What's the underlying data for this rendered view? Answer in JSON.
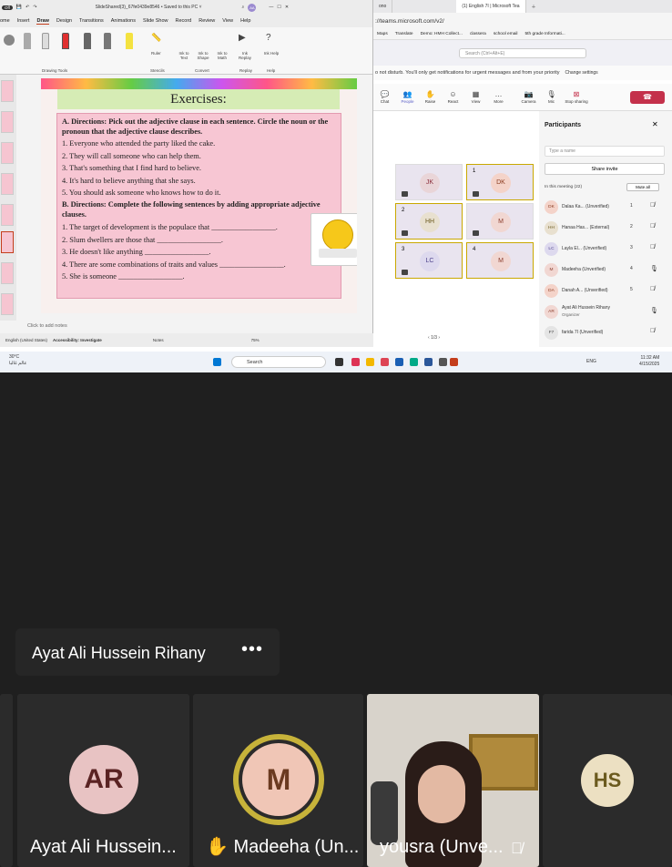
{
  "ppt": {
    "autosave": "Off",
    "filename": "SlideShared(3)_67fe0439e8546 • Saved to this PC ˅",
    "user_initials": "AA",
    "menu": [
      "ome",
      "Insert",
      "Draw",
      "Design",
      "Transitions",
      "Animations",
      "Slide Show",
      "Record",
      "Review",
      "View",
      "Help"
    ],
    "ribbon_labels": {
      "drawing_tools": "Drawing Tools",
      "stencils": "Stencils",
      "convert": "Convert",
      "replay": "Replay",
      "help": "Help",
      "ruler": "Ruler",
      "ink_to_text": "Ink to Text",
      "ink_to_shape": "Ink to Shape",
      "ink_to_math": "Ink to Math",
      "ink_replay": "Ink Replay",
      "ink_help": "Ink Help"
    },
    "notes_placeholder": "Click to add notes",
    "status": {
      "language": "English (United States)",
      "accessibility": "Accessibility: Investigate",
      "notes": "Notes",
      "zoom": "75%"
    }
  },
  "slide": {
    "title": "Exercises:",
    "section_a": "A. Directions: Pick out the adjective clause in each sentence. Circle the noun or the pronoun that the adjective clause describes.",
    "a_items": [
      "1. Everyone who attended the party liked the cake.",
      "2. They will call someone who can help them.",
      "3. That's something that I find hard to believe.",
      "4. It's hard to believe anything that she says.",
      "5. You should ask someone who knows how to do it."
    ],
    "section_b": "B. Directions: Complete the following sentences by adding appropriate adjective clauses.",
    "b_items": [
      "1.   The target of development is the populace that _________________.",
      "2.   Slum dwellers are those that _________________.",
      "3.   He doesn't like anything _________________.",
      "4.   There are some combinations of traits and values _________________.",
      "5.   She is someone _________________."
    ]
  },
  "browser": {
    "tabs": [
      "ono",
      "(1) English 7I | Microsoft Tea"
    ],
    "url": "://teams.microsoft.com/v2/",
    "bookmarks": [
      "Maps",
      "Translate",
      "Demo: HMH Collect...",
      "classera",
      "school email",
      "5th grade Informati..."
    ],
    "search_placeholder": "Search (Ctrl+Alt+E)",
    "banner": "o not disturb. You'll only get notifications for urgent messages and from your priority",
    "change_settings": "Change settings",
    "meeting_controls": [
      "Chat",
      "People",
      "Raise",
      "React",
      "View",
      "More",
      "Camera",
      "Mic",
      "Stop sharing"
    ],
    "people_badge": "22",
    "tiles": [
      {
        "initials": "JK",
        "num": "",
        "color": "#e9d5d8",
        "fg": "#8a2d3b",
        "hl": false
      },
      {
        "initials": "DK",
        "num": "1",
        "color": "#f4d3c9",
        "fg": "#8a3b1f",
        "hl": true
      },
      {
        "initials": "HH",
        "num": "2",
        "color": "#e8e0cf",
        "fg": "#6b5a1e",
        "hl": true
      },
      {
        "initials": "M",
        "num": "",
        "color": "#f1d7d2",
        "fg": "#8a3b2a",
        "hl": false
      },
      {
        "initials": "LC",
        "num": "3",
        "color": "#ddd9ee",
        "fg": "#4b3f8a",
        "hl": true
      },
      {
        "initials": "M",
        "num": "4",
        "color": "#f1d7d2",
        "fg": "#8a3b2a",
        "hl": true
      }
    ],
    "pager": "1/3"
  },
  "participants": {
    "title": "Participants",
    "search_placeholder": "Type a name",
    "share_invite": "Share invite",
    "in_meeting": "In this meeting (22)",
    "mute_all": "Mute all",
    "list": [
      {
        "initials": "DK",
        "name": "Dalaa Ka... (Unverified)",
        "badge": "1",
        "color": "#f4d3c9",
        "fg": "#8a3b1f",
        "mic": "off"
      },
      {
        "initials": "HH",
        "name": "Hanaa Has... (External)",
        "badge": "2",
        "color": "#e8e0cf",
        "fg": "#6b5a1e",
        "mic": "off"
      },
      {
        "initials": "LC",
        "name": "Layla El... (Unverified)",
        "badge": "3",
        "color": "#ddd9ee",
        "fg": "#4b3f8a",
        "mic": "off"
      },
      {
        "initials": "M",
        "name": "Madeeha (Unverified)",
        "badge": "4",
        "color": "#f1d7d2",
        "fg": "#8a3b2a",
        "mic": "on"
      },
      {
        "initials": "DA",
        "name": "Danah A... (Unverified)",
        "badge": "5",
        "color": "#f4d3c9",
        "fg": "#8a3b1f",
        "mic": "off"
      },
      {
        "initials": "AR",
        "name": "Ayat Ali Hussein Rihany",
        "badge": "",
        "color": "#f1d7d2",
        "fg": "#8a3b2a",
        "mic": "on",
        "role": "Organizer"
      },
      {
        "initials": "F7",
        "name": "farida 7I (Unverified)",
        "badge": "",
        "color": "#e4e4e4",
        "fg": "#444",
        "mic": "off"
      }
    ]
  },
  "taskbar": {
    "weather_temp": "30°C",
    "weather_desc": "عالم غالبا",
    "search": "Search",
    "lang": "ENG",
    "time": "11:32 AM",
    "date": "4/15/2025"
  },
  "meeting": {
    "presenter_name": "Ayat Ali Hussein Rihany",
    "more": "•••",
    "tiles": [
      {
        "initials": "AR",
        "name": "Ayat Ali Hussein...",
        "color": "#e8c3c3",
        "fg": "#5a2323"
      },
      {
        "initials": "M",
        "name": "✋ Madeeha (Un...",
        "color": "#f0c6b6",
        "fg": "#6b3a20"
      },
      {
        "initials": "",
        "name": "yousra (Unve...",
        "color": "",
        "fg": ""
      },
      {
        "initials": "HS",
        "name": "",
        "color": "#ece0c2",
        "fg": "#6b5a1e"
      }
    ]
  }
}
